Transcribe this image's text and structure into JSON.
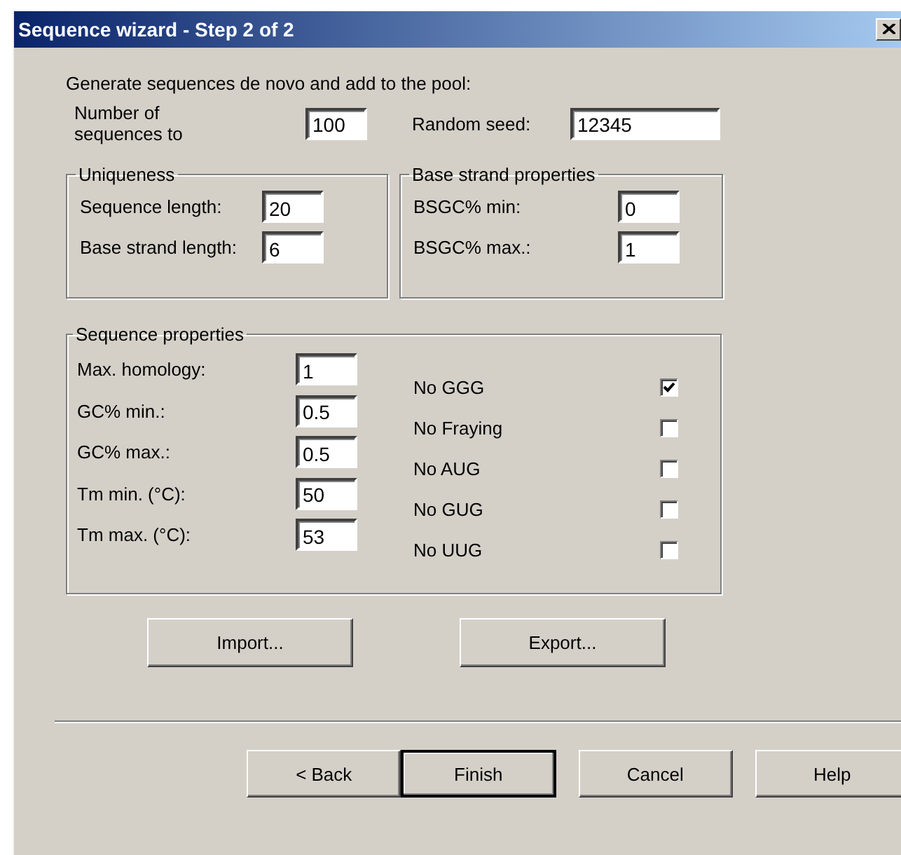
{
  "window": {
    "title": "Sequence wizard - Step 2 of 2"
  },
  "intro": "Generate sequences de novo and add to the pool:",
  "top_fields": [
    {
      "label": "Number of sequences to",
      "value": "100"
    },
    {
      "label": "Random seed:",
      "value": "12345"
    }
  ],
  "uniqueness": {
    "title": "Uniqueness",
    "fields": [
      {
        "label": "Sequence length:",
        "value": "20"
      },
      {
        "label": "Base strand length:",
        "value": "6"
      }
    ]
  },
  "base_strand_properties": {
    "title": "Base strand properties",
    "fields": [
      {
        "label": "BSGC% min:",
        "value": "0"
      },
      {
        "label": "BSGC% max.:",
        "value": "1"
      }
    ]
  },
  "sequence_properties": {
    "title": "Sequence properties",
    "fields": [
      {
        "label": "Max. homology:",
        "value": "1"
      },
      {
        "label": "GC% min.:",
        "value": "0.5"
      },
      {
        "label": "GC% max.:",
        "value": "0.5"
      },
      {
        "label": "Tm min. (°C):",
        "value": "50"
      },
      {
        "label": "Tm max. (°C):",
        "value": "53"
      }
    ],
    "options": [
      {
        "label": "No GGG",
        "checked": true
      },
      {
        "label": "No Fraying",
        "checked": false
      },
      {
        "label": "No AUG",
        "checked": false
      },
      {
        "label": "No GUG",
        "checked": false
      },
      {
        "label": "No UUG",
        "checked": false
      }
    ]
  },
  "actions": [
    "Import...",
    "Export..."
  ],
  "buttons": [
    {
      "label": "< Back",
      "default": false
    },
    {
      "label": "Finish",
      "default": true
    },
    {
      "label": "Cancel",
      "default": false
    },
    {
      "label": "Help",
      "default": false
    }
  ]
}
